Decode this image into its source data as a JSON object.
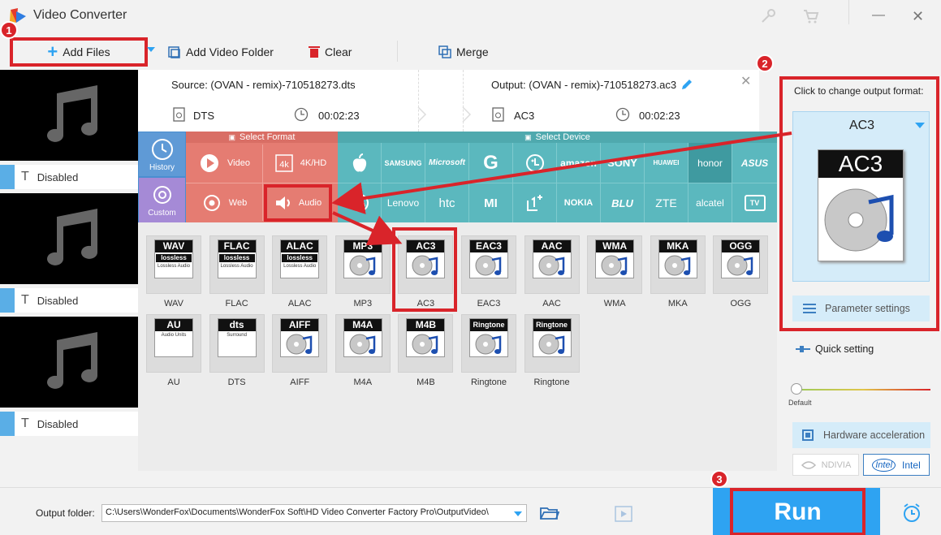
{
  "app": {
    "title": "Video Converter"
  },
  "toolbar": {
    "add_files": "Add Files",
    "add_folder": "Add Video Folder",
    "clear": "Clear",
    "merge": "Merge"
  },
  "files": [
    {
      "subtitle": "Disabled"
    },
    {
      "subtitle": "Disabled"
    },
    {
      "subtitle": "Disabled"
    }
  ],
  "info": {
    "source": "Source: (OVAN -  remix)-710518273.dts",
    "output": "Output: (OVAN -  remix)-710518273.ac3",
    "src_format": "DTS",
    "src_duration": "00:02:23",
    "out_format": "AC3",
    "out_duration": "00:02:23"
  },
  "categories": {
    "select_format": "Select Format",
    "select_device": "Select Device",
    "history": "History",
    "custom": "Custom",
    "video": "Video",
    "hd": "4K/HD",
    "web": "Web",
    "audio": "Audio"
  },
  "devices_row1": [
    "SAMSUNG",
    "Microsoft",
    "amazon",
    "SONY",
    "HUAWEI",
    "honor",
    "ASUS"
  ],
  "devices_row2": [
    "Lenovo",
    "htc",
    "MI",
    "NOKIA",
    "BLU",
    "ZTE",
    "alcatel",
    "TV"
  ],
  "formats_row1": [
    {
      "badge": "WAV",
      "sub": "lossless",
      "sub2": "Lossless Audio",
      "label": "WAV"
    },
    {
      "badge": "FLAC",
      "sub": "lossless",
      "sub2": "Lossless Audio",
      "label": "FLAC"
    },
    {
      "badge": "ALAC",
      "sub": "lossless",
      "sub2": "Lossless Audio",
      "label": "ALAC"
    },
    {
      "badge": "MP3",
      "label": "MP3"
    },
    {
      "badge": "AC3",
      "label": "AC3"
    },
    {
      "badge": "EAC3",
      "label": "EAC3"
    },
    {
      "badge": "AAC",
      "label": "AAC"
    },
    {
      "badge": "WMA",
      "label": "WMA"
    },
    {
      "badge": "MKA",
      "label": "MKA"
    },
    {
      "badge": "OGG",
      "label": "OGG"
    }
  ],
  "formats_row2": [
    {
      "badge": "AU",
      "sub2": "Audio Units",
      "label": "AU"
    },
    {
      "badge": "dts",
      "sub2": "Surround",
      "label": "DTS"
    },
    {
      "badge": "AIFF",
      "label": "AIFF"
    },
    {
      "badge": "M4A",
      "label": "M4A"
    },
    {
      "badge": "M4B",
      "label": "M4B"
    },
    {
      "badge": "Ringtone",
      "label": "Ringtone"
    },
    {
      "badge": "Ringtone",
      "label": "Ringtone"
    }
  ],
  "right": {
    "click_change": "Click to change output format:",
    "current_format": "AC3",
    "param_settings": "Parameter settings",
    "quick_setting": "Quick setting",
    "default_label": "Default",
    "hw_accel": "Hardware acceleration",
    "nvidia": "NDIVIA",
    "intel": "Intel"
  },
  "bottom": {
    "output_folder_label": "Output folder:",
    "output_path": "C:\\Users\\WonderFox\\Documents\\WonderFox Soft\\HD Video Converter Factory Pro\\OutputVideo\\",
    "run": "Run"
  },
  "steps": [
    "1",
    "2",
    "3"
  ],
  "colors": {
    "accent_blue": "#2ea3f2",
    "red_highlight": "#d9242a",
    "device_teal": "#5bb8be",
    "format_salmon": "#e57c72",
    "category_purple": "#a58ad6"
  }
}
